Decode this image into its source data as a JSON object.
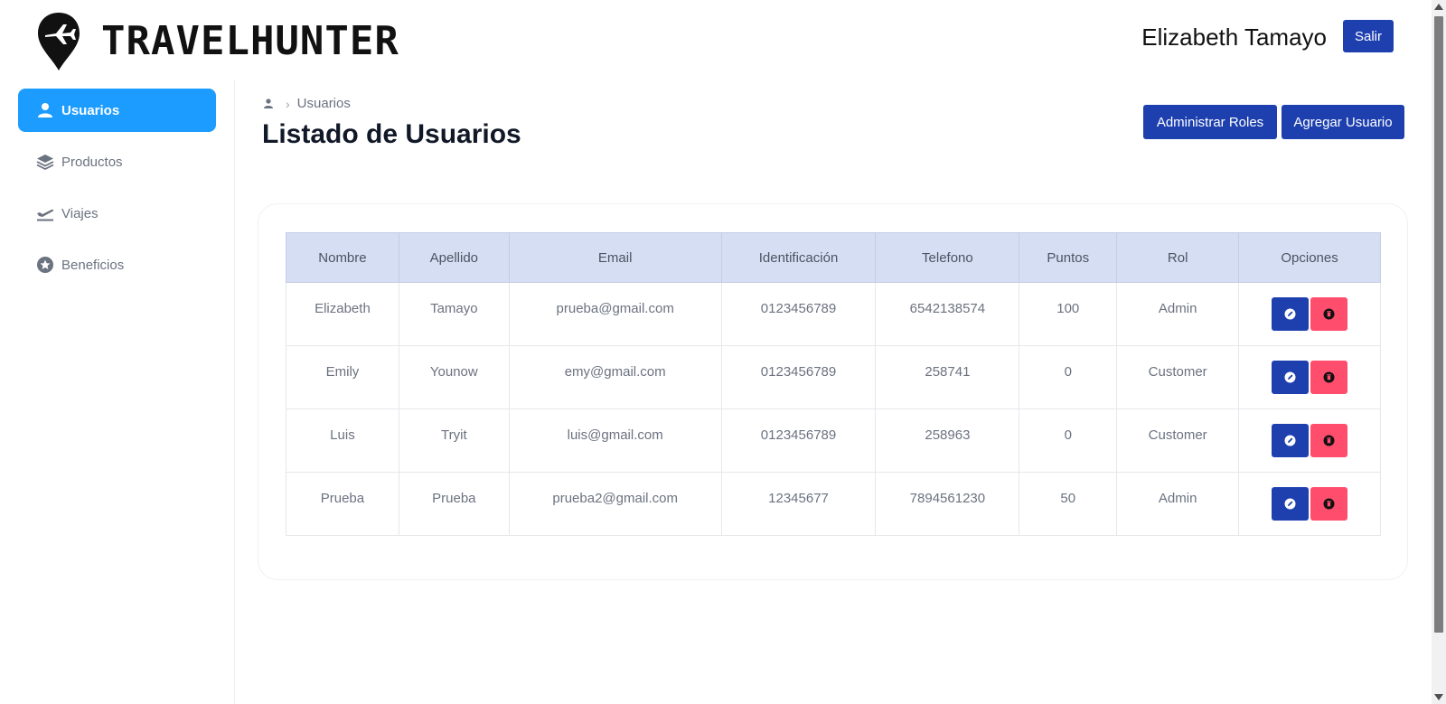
{
  "header": {
    "logo_text": "TRAVELHUNTER",
    "user_name": "Elizabeth Tamayo",
    "logout_label": "Salir"
  },
  "sidebar": {
    "items": [
      {
        "label": "Usuarios",
        "icon": "user-icon",
        "active": true
      },
      {
        "label": "Productos",
        "icon": "layers-icon",
        "active": false
      },
      {
        "label": "Viajes",
        "icon": "plane-departure-icon",
        "active": false
      },
      {
        "label": "Beneficios",
        "icon": "star-circle-icon",
        "active": false
      }
    ]
  },
  "breadcrumb": {
    "icon": "user-icon",
    "current": "Usuarios"
  },
  "main": {
    "title": "Listado de Usuarios",
    "roles_button": "Administrar Roles",
    "add_button": "Agregar Usuario"
  },
  "table": {
    "headers": [
      "Nombre",
      "Apellido",
      "Email",
      "Identificación",
      "Telefono",
      "Puntos",
      "Rol",
      "Opciones"
    ],
    "rows": [
      [
        "Elizabeth",
        "Tamayo",
        "prueba@gmail.com",
        "0123456789",
        "6542138574",
        "100",
        "Admin"
      ],
      [
        "Emily",
        "Younow",
        "emy@gmail.com",
        "0123456789",
        "258741",
        "0",
        "Customer"
      ],
      [
        "Luis",
        "Tryit",
        "luis@gmail.com",
        "0123456789",
        "258963",
        "0",
        "Customer"
      ],
      [
        "Prueba",
        "Prueba",
        "prueba2@gmail.com",
        "12345677",
        "7894561230",
        "50",
        "Admin"
      ]
    ]
  },
  "colors": {
    "primary": "#1e40af",
    "active_nav": "#1c9cff",
    "danger": "#ff4d6d",
    "table_header": "#d6def3"
  }
}
